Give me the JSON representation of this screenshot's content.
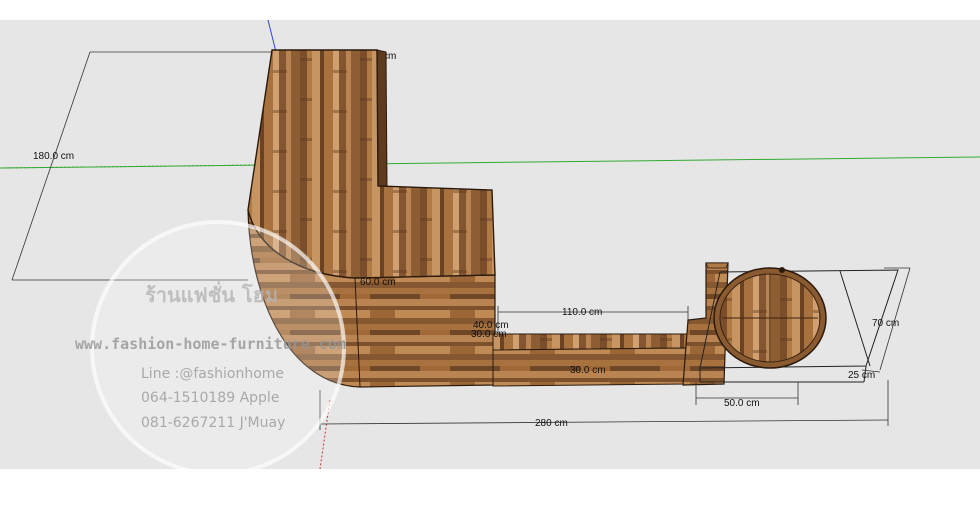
{
  "colors": {
    "background": "#e6e6e6",
    "axis_green": "#33aa33",
    "axis_blue": "#3344cc",
    "axis_red": "#cc3333",
    "wood_dark": "#6b4324",
    "wood_mid": "#9a6a3a",
    "wood_light": "#c08a55"
  },
  "dimensions": {
    "depth_label": "180.0 cm",
    "top_label": "cm",
    "corner_label": "60.0 cm",
    "length_label": "110.0 cm",
    "small_a_label": "40.0 cm",
    "small_b_label": "30.0 cm",
    "inner_label": "30.0 cm",
    "total_label": "280 cm",
    "door_width_label": "50.0 cm",
    "door_height_label": "70 cm",
    "door_depth_label": "25 cm"
  },
  "watermark": {
    "shop_name": "ร้านแฟชั่น โฮม",
    "website": "www.fashion-home-furniture.com",
    "line_id": "Line :@fashionhome",
    "phone_1": "064-1510189 Apple",
    "phone_2": "081-6267211 J'Muay"
  }
}
